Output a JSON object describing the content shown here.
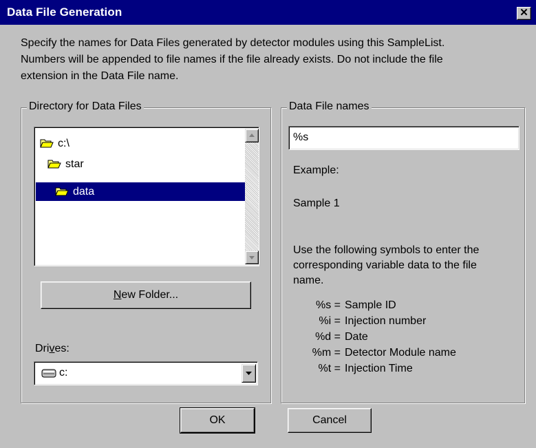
{
  "window": {
    "title": "Data File Generation",
    "close_glyph": "✕"
  },
  "intro": {
    "lines": [
      "Specify the names for Data Files generated by detector modules using this SampleList.",
      "Numbers will be appended to file names if the file already exists. Do not include the file",
      "extension in the Data File name."
    ]
  },
  "directory_group": {
    "label": "Directory for Data Files",
    "tree": [
      {
        "label": "c:\\",
        "icon": "open-folder-icon",
        "selected": false
      },
      {
        "label": "star",
        "icon": "open-folder-icon",
        "selected": false
      },
      {
        "label": "data",
        "icon": "open-folder-icon",
        "selected": true
      }
    ],
    "new_folder_button": {
      "underlined": "N",
      "rest": "ew Folder..."
    },
    "drives_label": {
      "before": "Dri",
      "underlined": "v",
      "after": "es:"
    },
    "drive_value": "c:"
  },
  "names_group": {
    "label": "Data File names",
    "input_value": "%s",
    "example_label": "Example:",
    "example_value": "Sample 1",
    "instructions": [
      "Use the following symbols to enter the",
      "corresponding variable data to the file",
      "name."
    ],
    "symbols": [
      {
        "key": "%s =",
        "desc": "Sample ID"
      },
      {
        "key": "%i =",
        "desc": "Injection number"
      },
      {
        "key": "%d =",
        "desc": "Date"
      },
      {
        "key": "%m =",
        "desc": "Detector Module name"
      },
      {
        "key": "%t =",
        "desc": "Injection Time"
      }
    ]
  },
  "buttons": {
    "ok": "OK",
    "cancel": "Cancel"
  },
  "colors": {
    "titlebar": "#000080",
    "selection": "#000080",
    "face": "#c0c0c0",
    "folder": "#ffff00"
  }
}
